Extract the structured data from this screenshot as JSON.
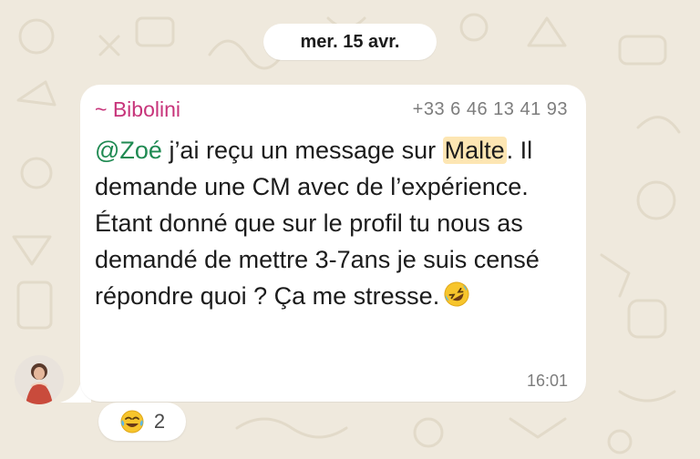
{
  "date_separator": "mer. 15 avr.",
  "message": {
    "sender": "~ Bibolini",
    "phone": "+33 6 46 13 41 93",
    "mention": "@Zoé",
    "text_part1": " j’ai reçu un message sur ",
    "highlight": "Malte",
    "text_part2": ". Il demande une CM avec de l’expérience. Étant donné que sur le profil tu nous as demandé de mettre 3-7ans je suis censé répondre quoi ? Ça me stresse.",
    "emoji": "rolling-on-floor-laughing-emoji",
    "time": "16:01"
  },
  "reaction": {
    "emoji": "joy-emoji",
    "count": "2"
  },
  "colors": {
    "background": "#efe9dd",
    "sender": "#c7347a",
    "mention": "#1f8a52",
    "highlight": "#fde6b3"
  }
}
